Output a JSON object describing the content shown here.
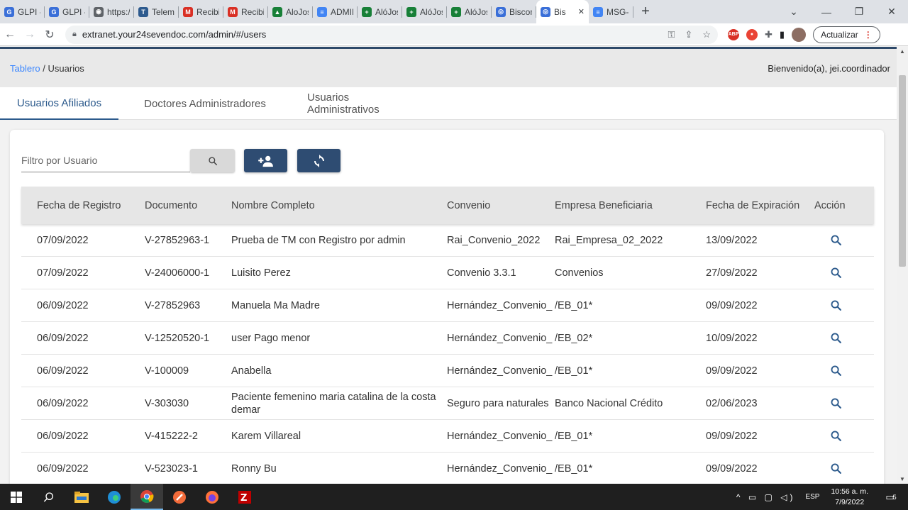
{
  "browser": {
    "tabs": [
      {
        "title": "GLPI -",
        "color": "#3a6fd8",
        "glyph": "G"
      },
      {
        "title": "GLPI -",
        "color": "#3a6fd8",
        "glyph": "G"
      },
      {
        "title": "https:/",
        "color": "#5f6368",
        "glyph": "◉"
      },
      {
        "title": "Teleme",
        "color": "#2d5a8e",
        "glyph": "T"
      },
      {
        "title": "Recibid",
        "color": "#d93025",
        "glyph": "M"
      },
      {
        "title": "Recibid",
        "color": "#d93025",
        "glyph": "M"
      },
      {
        "title": "AloJos",
        "color": "#188038",
        "glyph": "▲"
      },
      {
        "title": "ADMIN",
        "color": "#4285f4",
        "glyph": "≡"
      },
      {
        "title": "AlóJos",
        "color": "#188038",
        "glyph": "+"
      },
      {
        "title": "AlóJos",
        "color": "#188038",
        "glyph": "+"
      },
      {
        "title": "AlóJos",
        "color": "#188038",
        "glyph": "+"
      },
      {
        "title": "Biscom",
        "color": "#3a6fd8",
        "glyph": "◎"
      }
    ],
    "active_tab": {
      "title": "Bis",
      "color": "#3a6fd8",
      "glyph": "◎"
    },
    "last_tab": {
      "title": "MSG-N",
      "color": "#4285f4",
      "glyph": "≡"
    },
    "url": "extranet.your24sevendoc.com/admin/#/users",
    "update_label": "Actualizar"
  },
  "header": {
    "breadcrumb_home": "Tablero",
    "breadcrumb_sep": "/",
    "breadcrumb_current": "Usuarios",
    "welcome": "Bienvenido(a), jei.coordinador"
  },
  "nav_tabs": [
    "Usuarios Afiliados",
    "Doctores Administradores",
    "Usuarios Administrativos"
  ],
  "filter": {
    "placeholder": "Filtro por Usuario"
  },
  "table": {
    "columns": [
      "Fecha de Registro",
      "Documento",
      "Nombre Completo",
      "Convenio",
      "Empresa Beneficiaria",
      "Fecha de Expiración",
      "Acción"
    ],
    "rows": [
      {
        "fecha": "07/09/2022",
        "documento": "V-27852963-1",
        "nombre": "Prueba de TM con Registro por admin",
        "convenio": "Rai_Convenio_2022",
        "empresa": "Rai_Empresa_02_2022",
        "expiracion": "13/09/2022"
      },
      {
        "fecha": "07/09/2022",
        "documento": "V-24006000-1",
        "nombre": "Luisito Perez",
        "convenio": "Convenio 3.3.1",
        "empresa": "Convenios",
        "expiracion": "27/09/2022"
      },
      {
        "fecha": "06/09/2022",
        "documento": "V-27852963",
        "nombre": "Manuela Ma Madre",
        "convenio": "Hernández_Convenio_",
        "empresa": "/EB_01*",
        "expiracion": "09/09/2022"
      },
      {
        "fecha": "06/09/2022",
        "documento": "V-12520520-1",
        "nombre": "user Pago menor",
        "convenio": "Hernández_Convenio_",
        "empresa": "/EB_02*",
        "expiracion": "10/09/2022"
      },
      {
        "fecha": "06/09/2022",
        "documento": "V-100009",
        "nombre": "Anabella",
        "convenio": "Hernández_Convenio_",
        "empresa": "/EB_01*",
        "expiracion": "09/09/2022"
      },
      {
        "fecha": "06/09/2022",
        "documento": "V-303030",
        "nombre": "Paciente femenino maria catalina de la costa demar",
        "convenio": "Seguro para naturales",
        "empresa": "Banco Nacional Crédito",
        "expiracion": "02/06/2023"
      },
      {
        "fecha": "06/09/2022",
        "documento": "V-415222-2",
        "nombre": "Karem Villareal",
        "convenio": "Hernández_Convenio_",
        "empresa": "/EB_01*",
        "expiracion": "09/09/2022"
      },
      {
        "fecha": "06/09/2022",
        "documento": "V-523023-1",
        "nombre": "Ronny Bu",
        "convenio": "Hernández_Convenio_",
        "empresa": "/EB_01*",
        "expiracion": "09/09/2022"
      }
    ]
  },
  "taskbar": {
    "lang": "ESP",
    "time": "10:56 a. m.",
    "date": "7/9/2022",
    "notif_count": "5"
  },
  "colors": {
    "accent": "#2e4c72",
    "link": "#3a86ff",
    "search_icon": "#2c5a8c"
  }
}
